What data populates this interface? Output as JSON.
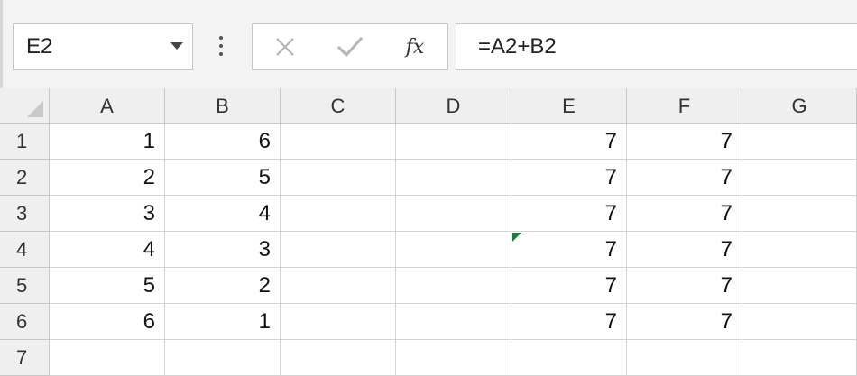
{
  "name_box": {
    "value": "E2"
  },
  "formula_buttons": {
    "cancel_icon": "x-icon",
    "enter_icon": "check-icon",
    "insert_function_label": "fx"
  },
  "formula_bar": {
    "value": "=A2+B2"
  },
  "columns": [
    "A",
    "B",
    "C",
    "D",
    "E",
    "F",
    "G"
  ],
  "rows": [
    {
      "header": "1",
      "cells": [
        "1",
        "6",
        "",
        "",
        "7",
        "7",
        ""
      ]
    },
    {
      "header": "2",
      "cells": [
        "2",
        "5",
        "",
        "",
        "7",
        "7",
        ""
      ]
    },
    {
      "header": "3",
      "cells": [
        "3",
        "4",
        "",
        "",
        "7",
        "7",
        ""
      ]
    },
    {
      "header": "4",
      "cells": [
        "4",
        "3",
        "",
        "",
        "7",
        "7",
        ""
      ]
    },
    {
      "header": "5",
      "cells": [
        "5",
        "2",
        "",
        "",
        "7",
        "7",
        ""
      ]
    },
    {
      "header": "6",
      "cells": [
        "6",
        "1",
        "",
        "",
        "7",
        "7",
        ""
      ]
    },
    {
      "header": "7",
      "cells": [
        "",
        "",
        "",
        "",
        "",
        "",
        ""
      ]
    }
  ],
  "colors": {
    "error_indicator": "#1d7d3a",
    "header_bg": "#efefef",
    "gridline": "#d4d4d4"
  }
}
